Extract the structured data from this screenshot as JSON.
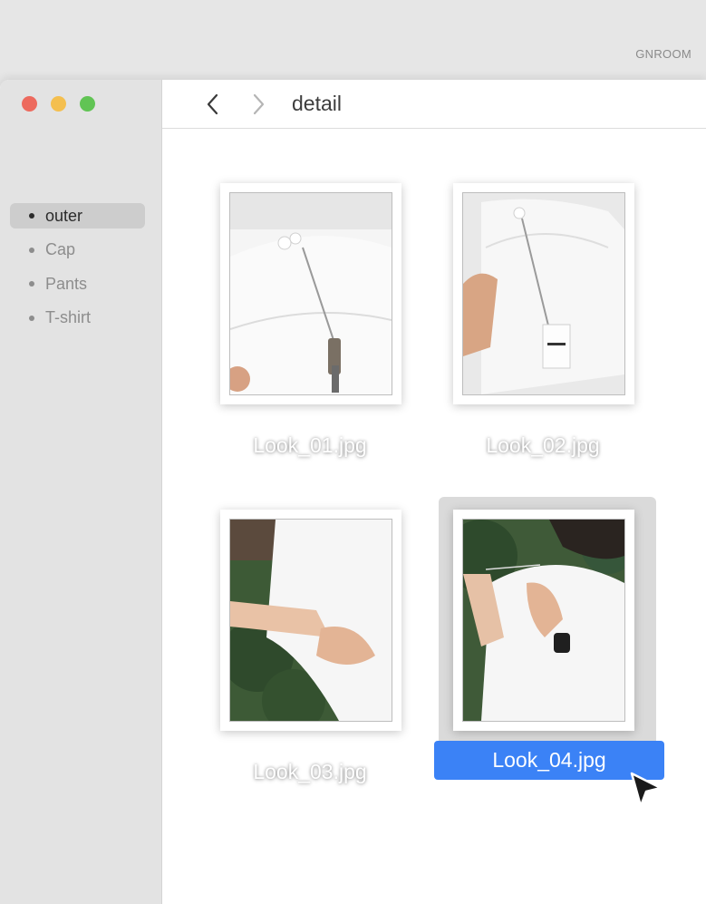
{
  "brand": "GNROOM",
  "window": {
    "title": "detail",
    "traffic_lights": {
      "close": "#ed6a5e",
      "minimize": "#f4bf4f",
      "zoom": "#61c454"
    }
  },
  "toolbar": {
    "back_icon": "chevron-left-icon",
    "forward_icon": "chevron-right-icon"
  },
  "sidebar": {
    "items": [
      {
        "label": "outer",
        "active": true
      },
      {
        "label": "Cap",
        "active": false
      },
      {
        "label": "Pants",
        "active": false
      },
      {
        "label": "T-shirt",
        "active": false
      }
    ]
  },
  "files": [
    {
      "name": "Look_01.jpg",
      "selected": false
    },
    {
      "name": "Look_02.jpg",
      "selected": false
    },
    {
      "name": "Look_03.jpg",
      "selected": false
    },
    {
      "name": "Look_04.jpg",
      "selected": true
    }
  ],
  "colors": {
    "selection_accent": "#3b82f6",
    "sidebar_bg": "#e3e3e3"
  }
}
